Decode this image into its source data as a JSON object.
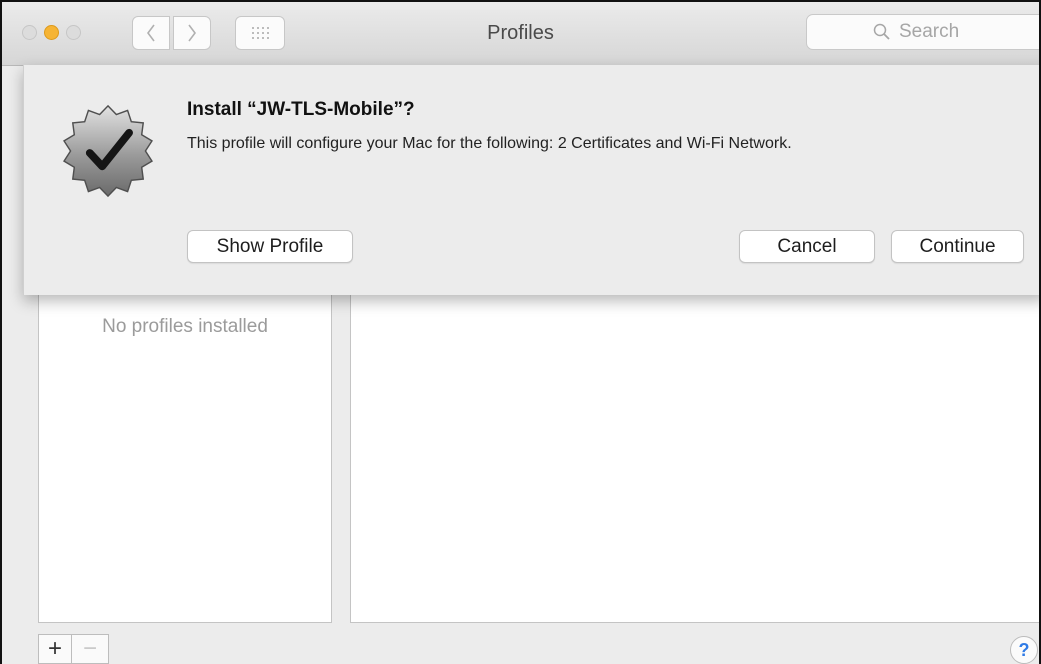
{
  "window": {
    "title": "Profiles",
    "search_placeholder": "Search"
  },
  "sheet": {
    "title": "Install “JW-TLS-Mobile”?",
    "message": "This profile will configure your Mac for the following: 2 Certificates and Wi-Fi Network.",
    "buttons": {
      "show_profile": "Show Profile",
      "cancel": "Cancel",
      "continue": "Continue"
    }
  },
  "profiles_list": {
    "empty_text": "No profiles installed"
  },
  "footer": {
    "add": "+",
    "remove": "−",
    "help": "?"
  },
  "icons": {
    "badge": "verified-badge-checkmark-icon",
    "search": "magnifier-icon"
  },
  "colors": {
    "minimize": "#f6b434",
    "help_accent": "#2f7be6"
  }
}
